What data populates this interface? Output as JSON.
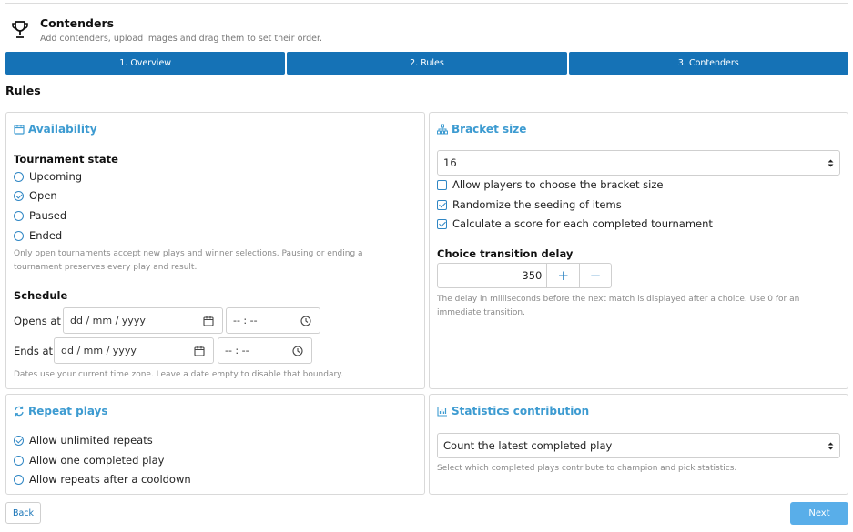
{
  "header": {
    "title": "Contenders",
    "subtitle": "Add contenders, upload images and drag them to set their order."
  },
  "steps": [
    "1. Overview",
    "2. Rules",
    "3. Contenders"
  ],
  "section_title": "Rules",
  "availability": {
    "title": "Availability",
    "state_label": "Tournament state",
    "states": [
      "Upcoming",
      "Open",
      "Paused",
      "Ended"
    ],
    "selected_state": "Open",
    "state_help_1": "Only open tournaments accept new plays and winner selections. Pausing or ending a",
    "state_help_2": "tournament preserves every play and result.",
    "schedule_label": "Schedule",
    "opens_label": "Opens at",
    "ends_label": "Ends at",
    "date_placeholder": "dd / mm / yyyy",
    "time_placeholder": "-- : --",
    "schedule_help": "Dates use your current time zone. Leave a date empty to disable that boundary."
  },
  "bracket": {
    "title": "Bracket size",
    "size_value": "16",
    "options": [
      {
        "label": "Allow players to choose the bracket size",
        "checked": false
      },
      {
        "label": "Randomize the seeding of items",
        "checked": true
      },
      {
        "label": "Calculate a score for each completed tournament",
        "checked": true
      }
    ],
    "delay_label": "Choice transition delay",
    "delay_value": "350",
    "plus": "+",
    "minus": "−",
    "delay_help_1": "The delay in milliseconds before the next match is displayed after a choice. Use 0 for an",
    "delay_help_2": "immediate transition."
  },
  "repeat": {
    "title": "Repeat plays",
    "options": [
      "Allow unlimited repeats",
      "Allow one completed play",
      "Allow repeats after a cooldown"
    ],
    "selected": "Allow unlimited repeats"
  },
  "statistics": {
    "title": "Statistics contribution",
    "value": "Count the latest completed play",
    "help": "Select which completed plays contribute to champion and pick statistics."
  },
  "footer": {
    "back": "Back",
    "next": "Next"
  },
  "colors": {
    "accent": "#1572b6",
    "card_title": "#3d9bd1",
    "next_button": "#59aee9"
  }
}
